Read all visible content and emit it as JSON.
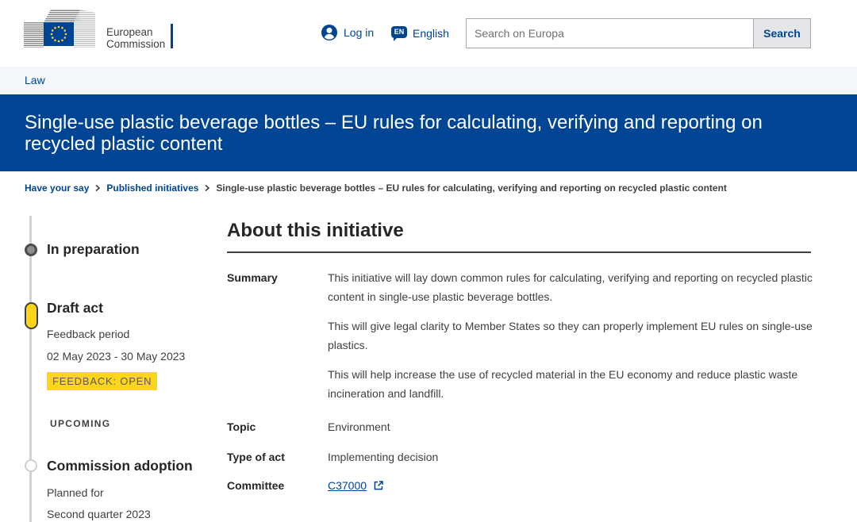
{
  "header": {
    "logo": {
      "line1": "European",
      "line2": "Commission",
      "icon": "eu-flag-icon"
    },
    "login": {
      "label": "Log in",
      "icon": "user-icon"
    },
    "language": {
      "code": "EN",
      "label": "English",
      "icon": "language-icon"
    },
    "search": {
      "placeholder": "Search on Europa",
      "value": "",
      "button_label": "Search"
    }
  },
  "site_name": {
    "label": "Law"
  },
  "page_title": "Single-use plastic beverage bottles – EU rules for calculating, verifying and reporting on recycled plastic content",
  "breadcrumb": {
    "separator_icon": "chevron-right-icon",
    "items": [
      {
        "label": "Have your say"
      },
      {
        "label": "Published initiatives"
      },
      {
        "label": "Single-use plastic beverage bottles – EU rules for calculating, verifying and reporting on recycled plastic content"
      }
    ]
  },
  "timeline": {
    "stages": [
      {
        "title": "In preparation",
        "marker_icon": "step-completed-icon"
      },
      {
        "title": "Draft act",
        "marker_icon": "step-current-icon",
        "detail_label": "Feedback period",
        "detail_value": "02 May 2023 - 30 May 2023",
        "badge": "FEEDBACK: OPEN"
      },
      {
        "title": "Commission adoption",
        "marker_icon": "step-upcoming-icon",
        "detail_label": "Planned for",
        "detail_value": "Second quarter 2023"
      }
    ],
    "upcoming_label": "UPCOMING"
  },
  "initiative": {
    "heading": "About this initiative",
    "summary": {
      "label": "Summary",
      "paragraphs": [
        "This initiative will lay down common rules for calculating, verifying and reporting on recycled plastic content in single-use plastic beverage bottles.",
        "This will give legal clarity to Member States so they can properly implement EU rules on single-use plastics.",
        "This will help increase the use of recycled material in the EU economy and reduce plastic waste incineration and landfill."
      ]
    },
    "topic": {
      "label": "Topic",
      "value": "Environment"
    },
    "type_of_act": {
      "label": "Type of act",
      "value": "Implementing decision"
    },
    "committee": {
      "label": "Committee",
      "value": "C37000",
      "link_icon": "external-link-icon"
    }
  },
  "colors": {
    "brand_blue": "#004494",
    "highlight_yellow": "#ffd617",
    "site_band": "#f3f6fa",
    "text_dark": "#262626",
    "timeline_line": "#d2d2d2"
  }
}
